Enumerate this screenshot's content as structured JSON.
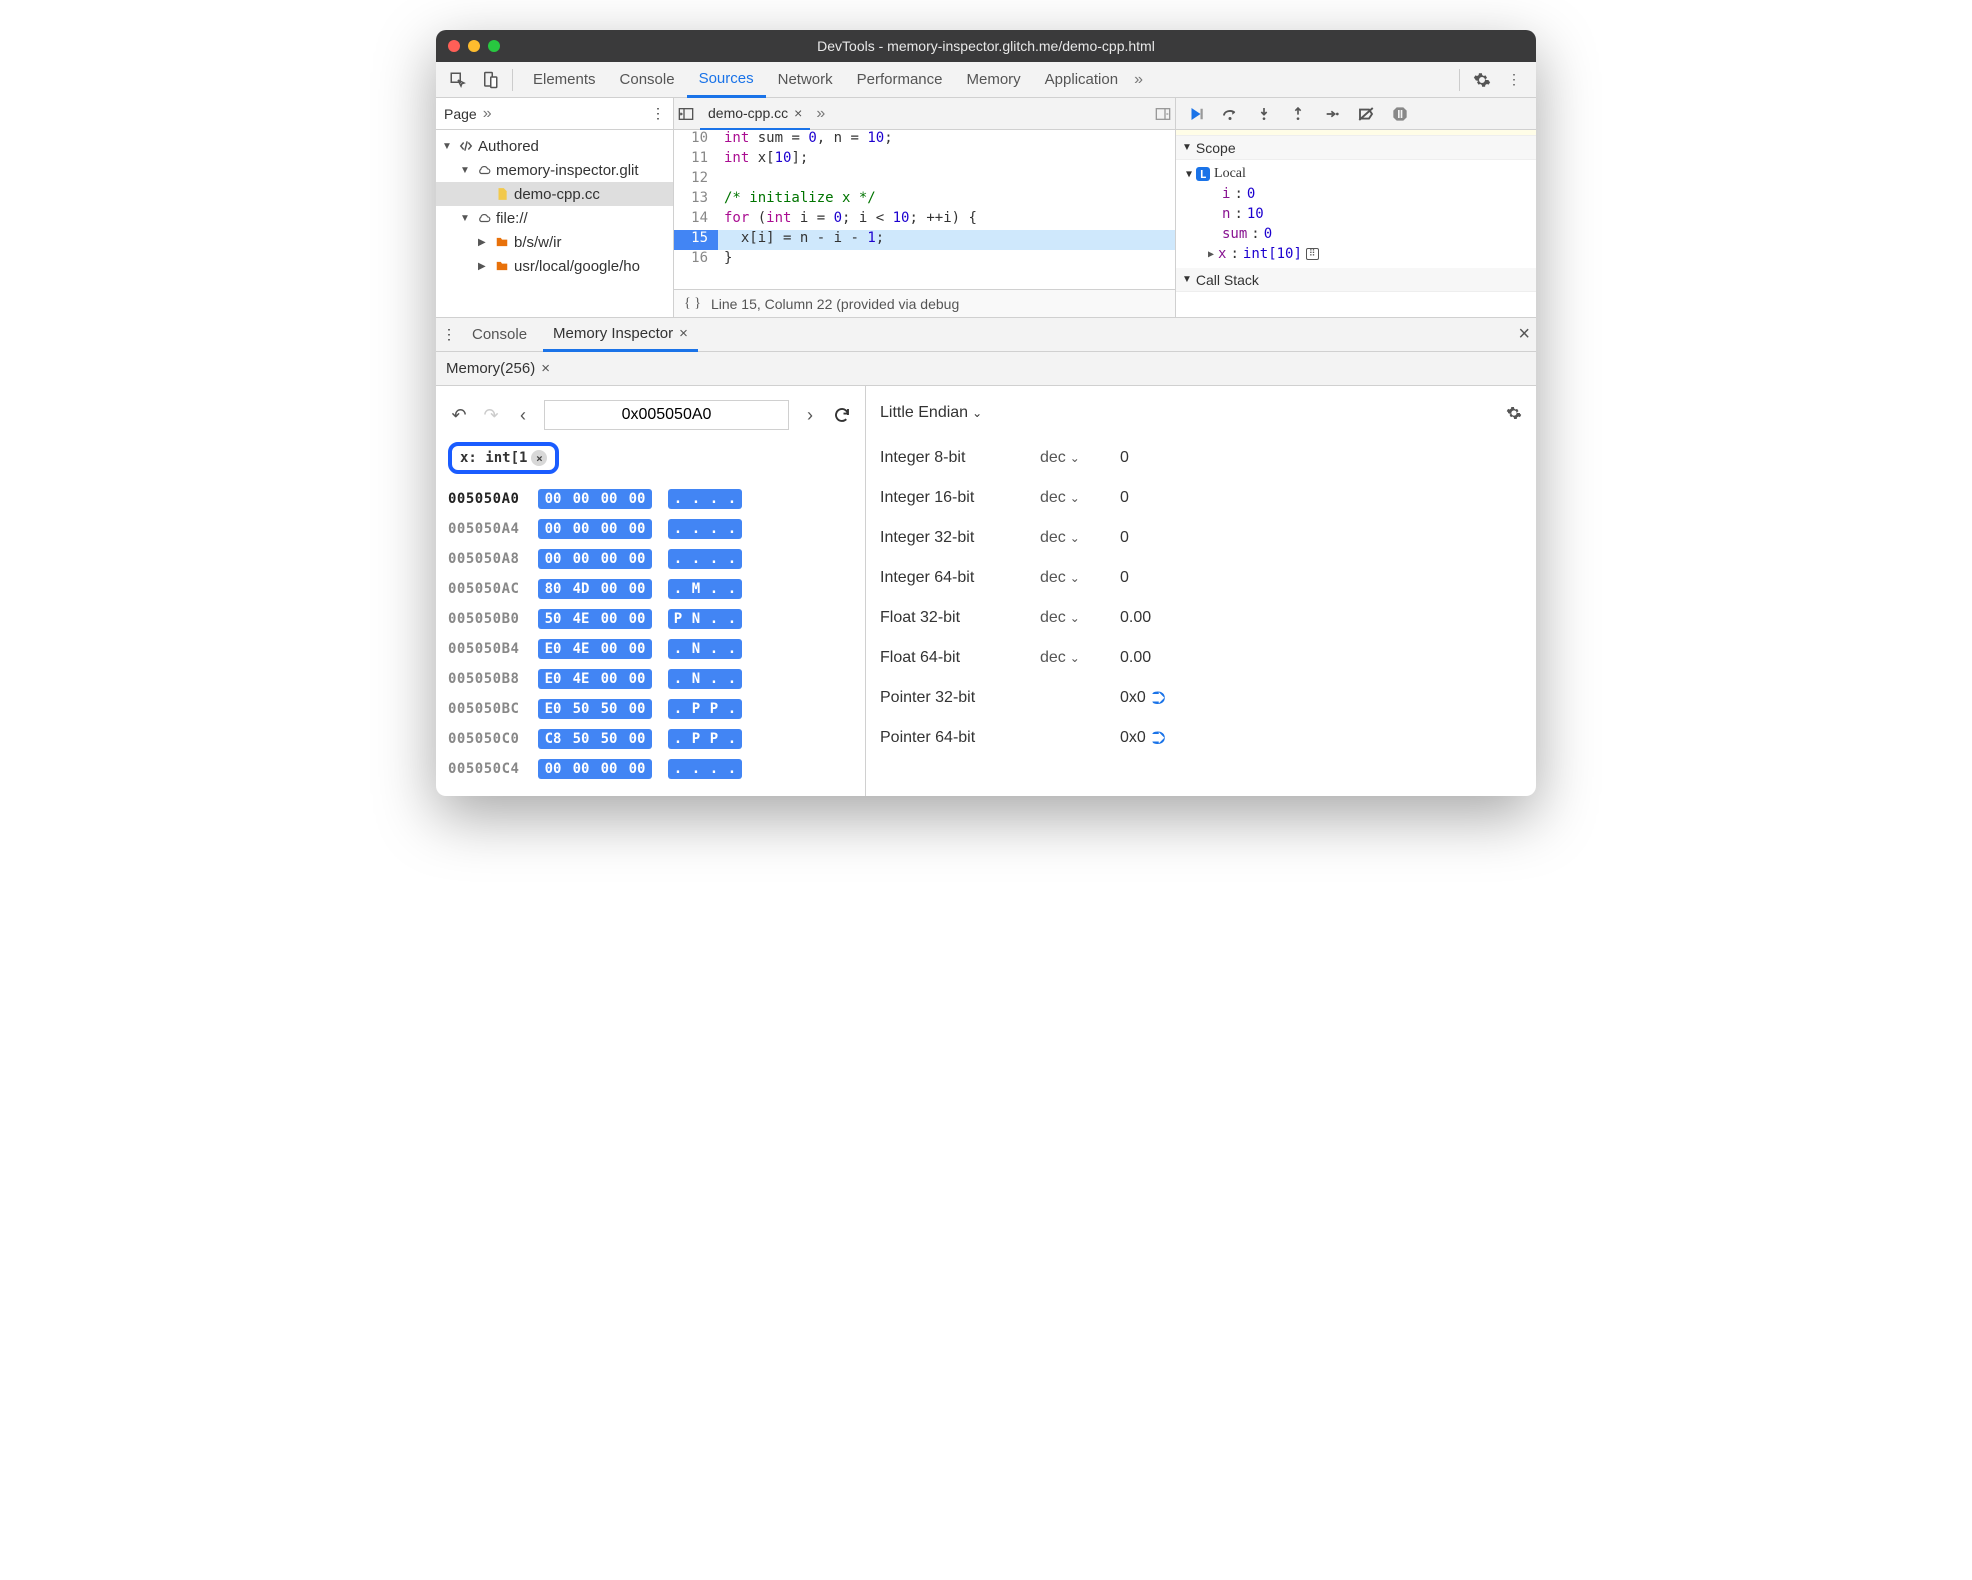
{
  "window": {
    "title": "DevTools - memory-inspector.glitch.me/demo-cpp.html"
  },
  "tabs": {
    "items": [
      "Elements",
      "Console",
      "Sources",
      "Network",
      "Performance",
      "Memory",
      "Application"
    ],
    "active": "Sources"
  },
  "navigator": {
    "tab": "Page",
    "tree": [
      {
        "label": "Authored",
        "icon": "code",
        "depth": 0,
        "expanded": true
      },
      {
        "label": "memory-inspector.glit",
        "icon": "cloud",
        "depth": 1,
        "expanded": true
      },
      {
        "label": "demo-cpp.cc",
        "icon": "file",
        "depth": 2,
        "selected": true
      },
      {
        "label": "file://",
        "icon": "cloud",
        "depth": 1,
        "expanded": true
      },
      {
        "label": "b/s/w/ir",
        "icon": "folder",
        "depth": 2,
        "expanded": false
      },
      {
        "label": "usr/local/google/ho",
        "icon": "folder",
        "depth": 2,
        "expanded": false
      }
    ]
  },
  "editor": {
    "tab": "demo-cpp.cc",
    "status": "Line 15, Column 22 (provided via debug",
    "lines": [
      {
        "n": 10,
        "html": "<span class='kw'>int</span> sum = <span class='num'>0</span>, n = <span class='num'>10</span>;"
      },
      {
        "n": 11,
        "html": "<span class='kw'>int</span> x[<span class='num'>10</span>];"
      },
      {
        "n": 12,
        "html": ""
      },
      {
        "n": 13,
        "html": "<span class='com'>/* initialize x */</span>"
      },
      {
        "n": 14,
        "html": "<span class='kw'>for</span> (<span class='kw'>int</span> i = <span class='num'>0</span>; i &lt; <span class='num'>10</span>; ++i) {"
      },
      {
        "n": 15,
        "html": "  x[i] = <span class='hl'>n</span> - i - <span class='num'>1</span>;",
        "exec": true
      },
      {
        "n": 16,
        "html": "}"
      }
    ]
  },
  "scope": {
    "title": "Scope",
    "local": "Local",
    "vars": [
      {
        "name": "i",
        "value": "0"
      },
      {
        "name": "n",
        "value": "10"
      },
      {
        "name": "sum",
        "value": "0"
      },
      {
        "name": "x",
        "value": "int[10]",
        "expandable": true,
        "memicon": true
      }
    ],
    "callstack": "Call Stack"
  },
  "drawer": {
    "tabs": {
      "console": "Console",
      "mi": "Memory Inspector"
    },
    "memtab": "Memory(256)"
  },
  "memory": {
    "address": "0x005050A0",
    "chip": "x: int[1",
    "endian": "Little Endian",
    "rows": [
      {
        "addr": "005050A0",
        "hex": [
          "00",
          "00",
          "00",
          "00"
        ],
        "ascii": [
          ".",
          ".",
          ".",
          "."
        ],
        "first": true
      },
      {
        "addr": "005050A4",
        "hex": [
          "00",
          "00",
          "00",
          "00"
        ],
        "ascii": [
          ".",
          ".",
          ".",
          "."
        ]
      },
      {
        "addr": "005050A8",
        "hex": [
          "00",
          "00",
          "00",
          "00"
        ],
        "ascii": [
          ".",
          ".",
          ".",
          "."
        ]
      },
      {
        "addr": "005050AC",
        "hex": [
          "80",
          "4D",
          "00",
          "00"
        ],
        "ascii": [
          ".",
          "M",
          ".",
          "."
        ]
      },
      {
        "addr": "005050B0",
        "hex": [
          "50",
          "4E",
          "00",
          "00"
        ],
        "ascii": [
          "P",
          "N",
          ".",
          "."
        ]
      },
      {
        "addr": "005050B4",
        "hex": [
          "E0",
          "4E",
          "00",
          "00"
        ],
        "ascii": [
          ".",
          "N",
          ".",
          "."
        ]
      },
      {
        "addr": "005050B8",
        "hex": [
          "E0",
          "4E",
          "00",
          "00"
        ],
        "ascii": [
          ".",
          "N",
          ".",
          "."
        ]
      },
      {
        "addr": "005050BC",
        "hex": [
          "E0",
          "50",
          "50",
          "00"
        ],
        "ascii": [
          ".",
          "P",
          "P",
          "."
        ]
      },
      {
        "addr": "005050C0",
        "hex": [
          "C8",
          "50",
          "50",
          "00"
        ],
        "ascii": [
          ".",
          "P",
          "P",
          "."
        ]
      },
      {
        "addr": "005050C4",
        "hex": [
          "00",
          "00",
          "00",
          "00"
        ],
        "ascii": [
          ".",
          ".",
          ".",
          "."
        ]
      }
    ],
    "values": [
      {
        "type": "Integer 8-bit",
        "mode": "dec",
        "value": "0"
      },
      {
        "type": "Integer 16-bit",
        "mode": "dec",
        "value": "0"
      },
      {
        "type": "Integer 32-bit",
        "mode": "dec",
        "value": "0"
      },
      {
        "type": "Integer 64-bit",
        "mode": "dec",
        "value": "0"
      },
      {
        "type": "Float 32-bit",
        "mode": "dec",
        "value": "0.00"
      },
      {
        "type": "Float 64-bit",
        "mode": "dec",
        "value": "0.00"
      },
      {
        "type": "Pointer 32-bit",
        "mode": "",
        "value": "0x0",
        "jump": true
      },
      {
        "type": "Pointer 64-bit",
        "mode": "",
        "value": "0x0",
        "jump": true
      }
    ]
  }
}
